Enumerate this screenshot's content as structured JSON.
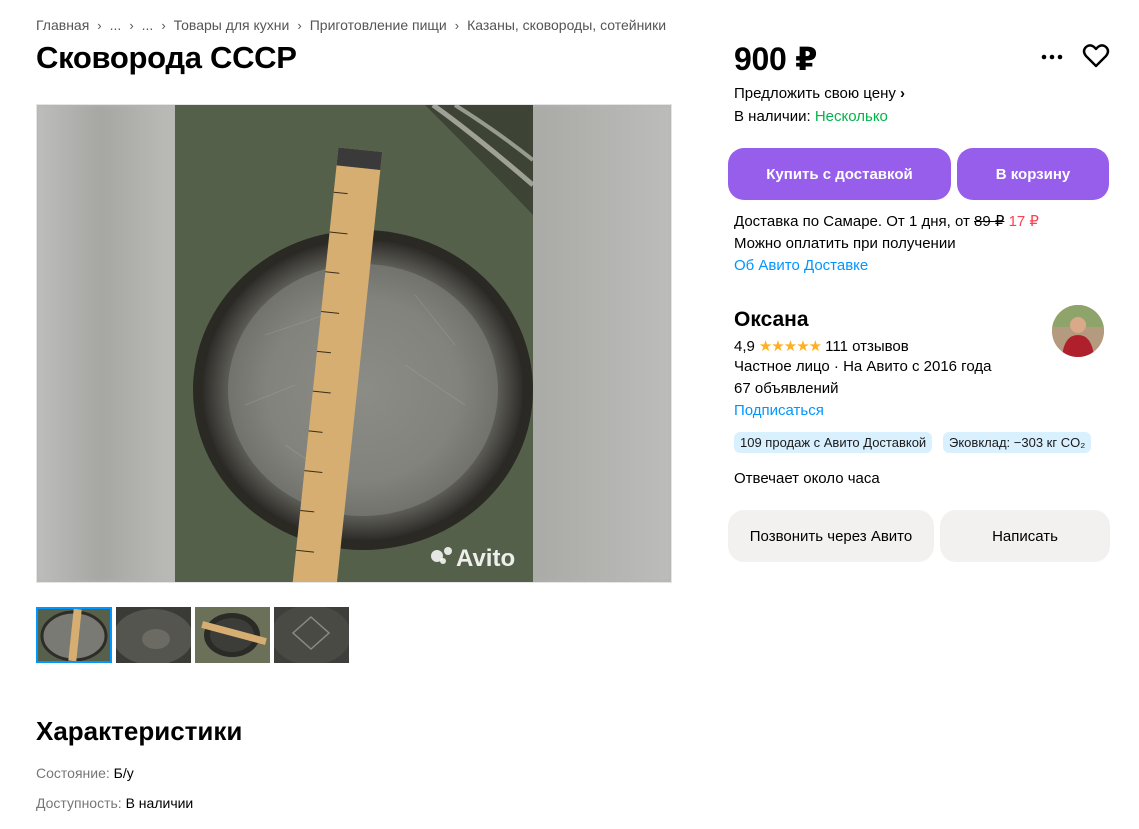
{
  "breadcrumbs": [
    "Главная",
    "...",
    "...",
    "Товары для кухни",
    "Приготовление пищи",
    "Казаны, сковороды, сотейники"
  ],
  "title": "Сковорода СССР",
  "price": "900 ₽",
  "offer_price": "Предложить свою цену",
  "stock": {
    "label": "В наличии: ",
    "value": "Несколько"
  },
  "buttons": {
    "buy_delivery": "Купить с доставкой",
    "cart": "В корзину",
    "call": "Позвонить через Авито",
    "message": "Написать"
  },
  "delivery": {
    "line1": "Доставка по Самаре. От 1 дня, от ",
    "old_price": "89 ₽",
    "new_price": "17 ₽",
    "line2": "Можно оплатить при получении",
    "link": "Об Авито Доставке"
  },
  "seller": {
    "name": "Оксана",
    "rating": "4,9",
    "stars": "★★★★★",
    "reviews": "111 отзывов",
    "type": "Частное лицо · На Авито с 2016 года",
    "ads": "67 объявлений",
    "subscribe": "Подписаться",
    "reply_time": "Отвечает около часа"
  },
  "chips": [
    "109 продаж с Авито Доставкой",
    "Эковклад: −303 кг CO₂"
  ],
  "watermark": "Avito",
  "characteristics": {
    "title": "Характеристики",
    "items": [
      {
        "key": "Состояние: ",
        "value": "Б/у"
      },
      {
        "key": "Доступность: ",
        "value": "В наличии"
      }
    ]
  },
  "colors": {
    "accent_purple": "#965eeb",
    "link_blue": "#0096ff",
    "green": "#02b34b",
    "red": "#ff4053",
    "chip_bg": "#d9f0ff"
  }
}
